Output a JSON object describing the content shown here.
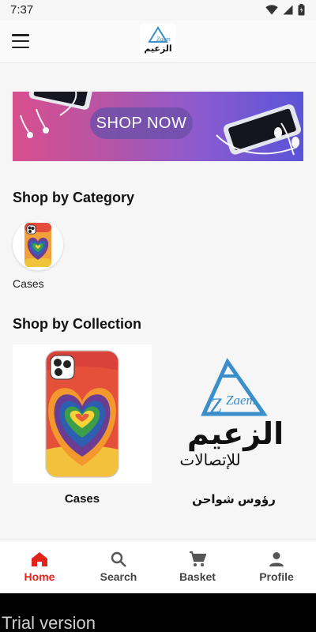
{
  "status_bar": {
    "time": "7:37"
  },
  "app_bar": {
    "logo_en": "Zaem",
    "logo_ar": "الزعيم"
  },
  "banner": {
    "button_label": "SHOP NOW"
  },
  "sections": {
    "category_title": "Shop by Category",
    "collection_title": "Shop by Collection"
  },
  "categories": [
    {
      "label": "Cases"
    }
  ],
  "collections": [
    {
      "label": "Cases"
    },
    {
      "label": "رؤوس شواحن",
      "logo_en": "Zaem",
      "logo_ar_title": "الزعيم",
      "logo_ar_sub": "للإتصالات"
    }
  ],
  "bottom_nav": [
    {
      "label": "Home",
      "icon": "home-icon",
      "active": true
    },
    {
      "label": "Search",
      "icon": "search-icon",
      "active": false
    },
    {
      "label": "Basket",
      "icon": "cart-icon",
      "active": false
    },
    {
      "label": "Profile",
      "icon": "person-icon",
      "active": false
    }
  ],
  "watermark": {
    "text": "Trial version"
  },
  "colors": {
    "accent": "#e2231a",
    "brand_blue": "#3a8ec9",
    "banner_start": "#d84f8e",
    "banner_end": "#5a54d8"
  }
}
